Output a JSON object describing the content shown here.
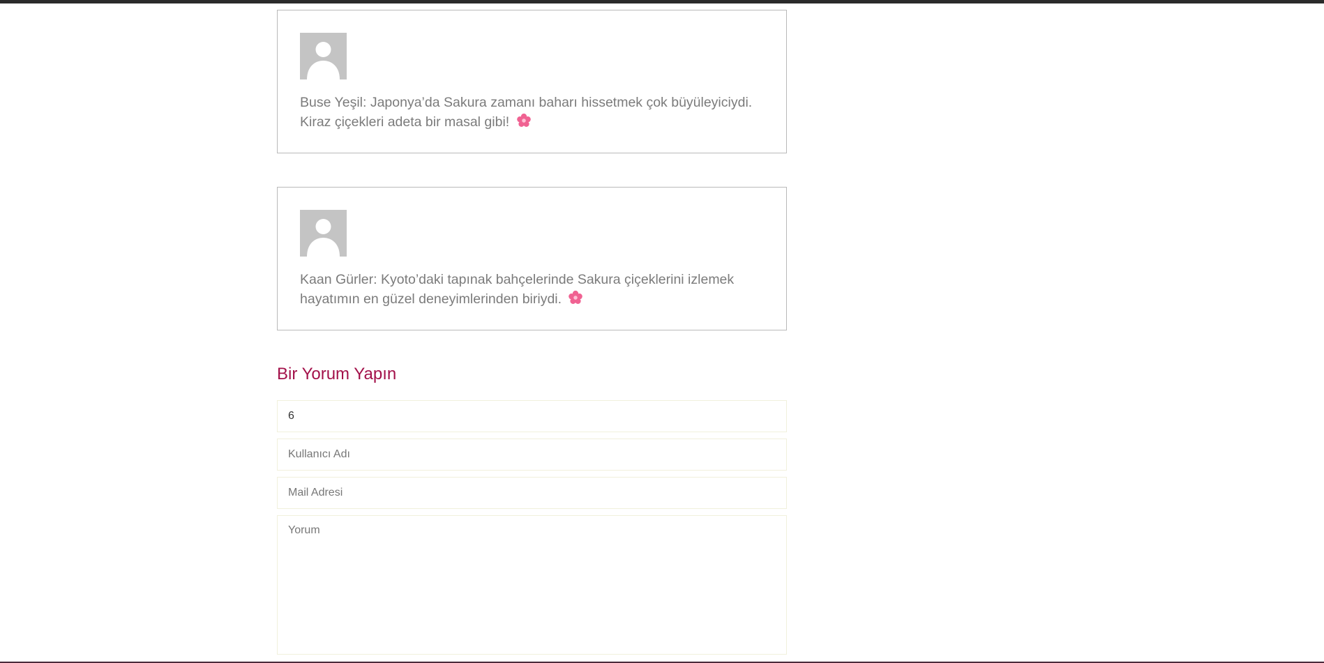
{
  "comments": [
    {
      "text": "Buse Yeşil: Japonya’da Sakura zamanı baharı hissetmek çok büyüleyiciydi. Kiraz çiçekleri adeta bir masal gibi!",
      "emoji_icon": "cherry-blossom-icon"
    },
    {
      "text": "Kaan Gürler: Kyoto’daki tapınak bahçelerinde Sakura çiçeklerini izlemek hayatımın en güzel deneyimlerinden biriydi.",
      "emoji_icon": "cherry-blossom-icon"
    }
  ],
  "form": {
    "title": "Bir Yorum Yapın",
    "id_value": "6",
    "username_placeholder": "Kullanıcı Adı",
    "email_placeholder": "Mail Adresi",
    "comment_placeholder": "Yorum"
  },
  "colors": {
    "accent": "#a3114a",
    "avatar_bg": "#c4c4c4",
    "flower": "#f06292"
  }
}
